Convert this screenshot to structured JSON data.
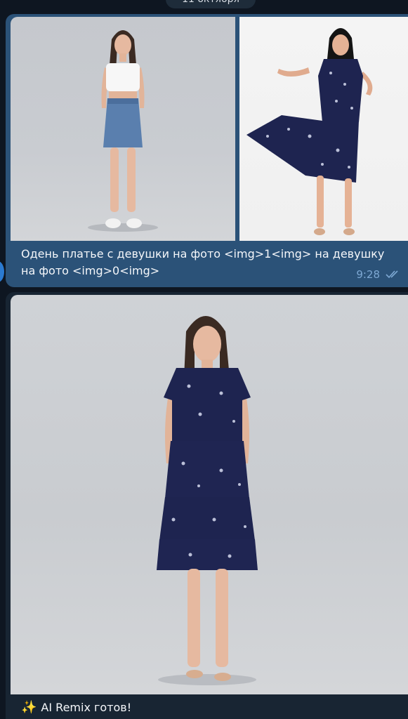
{
  "date_chip": "11 октября",
  "message_1": {
    "caption": "Одень платье с девушки на фото <img>1<img> на девушку на фото <img>0<img>",
    "time": "9:28",
    "status_icon": "double-check-icon"
  },
  "message_2": {
    "caption": "AI Remix готов!",
    "emoji_icon": "sparkles-icon",
    "emoji": "✨"
  },
  "colors": {
    "chat_background": "#0e1621",
    "outgoing_bubble": "#2b5278",
    "incoming_bubble": "#182533",
    "meta_text": "#7da8d3"
  }
}
